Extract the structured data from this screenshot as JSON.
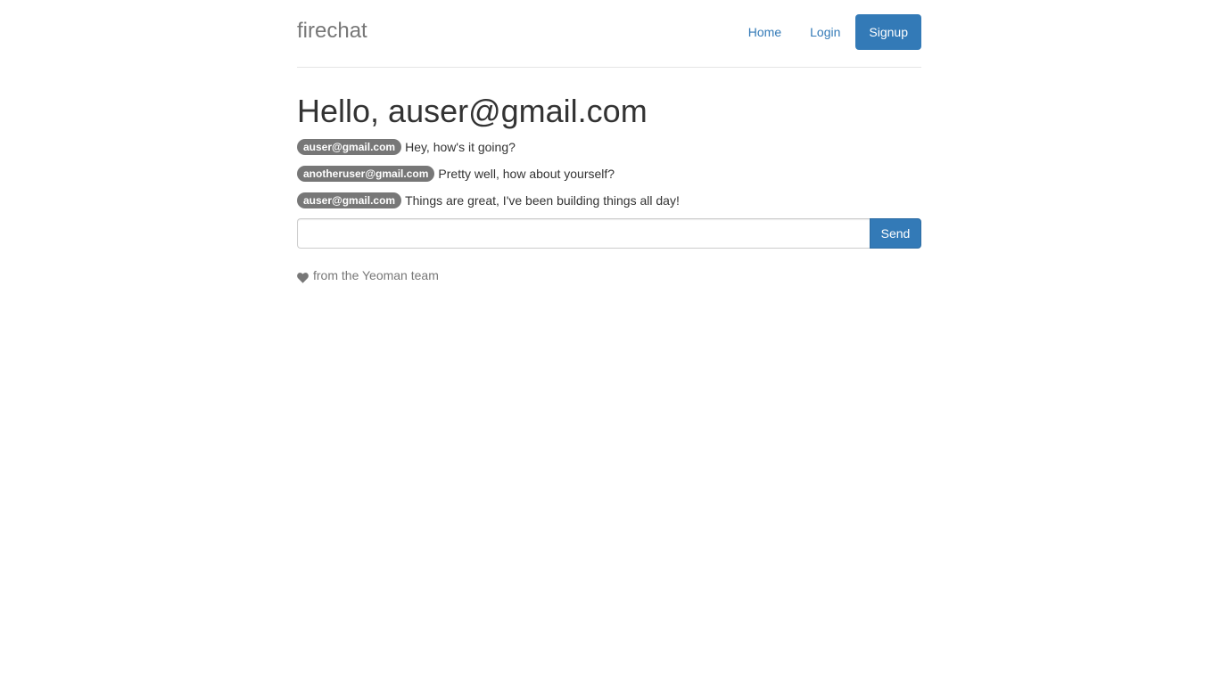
{
  "header": {
    "brand": "firechat",
    "nav": [
      {
        "label": "Home",
        "active": false
      },
      {
        "label": "Login",
        "active": false
      },
      {
        "label": "Signup",
        "active": true
      }
    ]
  },
  "main": {
    "greeting": "Hello, auser@gmail.com",
    "messages": [
      {
        "user": "auser@gmail.com",
        "text": "Hey, how's it going?"
      },
      {
        "user": "anotheruser@gmail.com",
        "text": "Pretty well, how about yourself?"
      },
      {
        "user": "auser@gmail.com",
        "text": "Things are great, I've been building things all day!"
      }
    ],
    "input": {
      "value": "",
      "placeholder": ""
    },
    "send_label": "Send"
  },
  "footer": {
    "icon": "heart-icon",
    "text": "from the Yeoman team"
  },
  "colors": {
    "primary": "#337ab7",
    "badge": "#777777",
    "brand": "#777777",
    "text": "#333333"
  }
}
